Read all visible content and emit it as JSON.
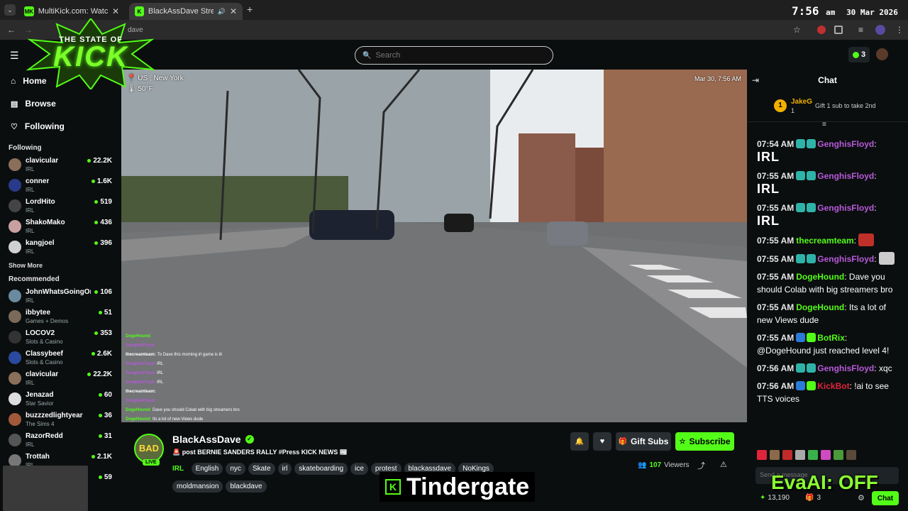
{
  "browser": {
    "tabs": [
      {
        "favicon": "MK",
        "title": "MultiKick.com: Watch Multiple"
      },
      {
        "favicon": "K",
        "title": "BlackAssDave Stream - Wat"
      }
    ],
    "url_fragment": "dave",
    "clock": {
      "time": "7:56",
      "ampm": "am",
      "date": "30 Mar 2026"
    }
  },
  "overlay": {
    "logo_line1": "THE STATE OF",
    "logo_line2": "KICK",
    "caption": "Tindergate",
    "evaai": "EvaAI: OFF"
  },
  "header": {
    "search_placeholder": "Search",
    "notification_count": "3"
  },
  "sidebar": {
    "nav": [
      {
        "label": "Home",
        "icon": "home-icon"
      },
      {
        "label": "Browse",
        "icon": "browse-icon"
      },
      {
        "label": "Following",
        "icon": "heart-icon"
      }
    ],
    "following_title": "Following",
    "following": [
      {
        "name": "clavicular",
        "category": "IRL",
        "viewers": "22.2K",
        "color": "#8a6f5a"
      },
      {
        "name": "conner",
        "category": "IRL",
        "viewers": "1.6K",
        "color": "#2a3a8a"
      },
      {
        "name": "LordHito",
        "category": "IRL",
        "viewers": "519",
        "color": "#444"
      },
      {
        "name": "ShakoMako",
        "category": "IRL",
        "viewers": "436",
        "color": "#c9a0a0"
      },
      {
        "name": "kangjoel",
        "category": "IRL",
        "viewers": "396",
        "color": "#d0d0d0"
      }
    ],
    "show_more": "Show More",
    "recommended_title": "Recommended",
    "recommended": [
      {
        "name": "JohnWhatsGoingOn",
        "category": "IRL",
        "viewers": "106",
        "color": "#6a8aa0"
      },
      {
        "name": "ibbytee",
        "category": "Games + Demos",
        "viewers": "51",
        "color": "#7a6a5a"
      },
      {
        "name": "LOCOV2",
        "category": "Slots & Casino",
        "viewers": "353",
        "color": "#333"
      },
      {
        "name": "Classybeef",
        "category": "Slots & Casino",
        "viewers": "2.6K",
        "color": "#2a4aa0"
      },
      {
        "name": "clavicular",
        "category": "IRL",
        "viewers": "22.2K",
        "color": "#8a6f5a"
      },
      {
        "name": "Jenazad",
        "category": "Star Savior",
        "viewers": "60",
        "color": "#ddd"
      },
      {
        "name": "buzzzedlightyear",
        "category": "The Sims 4",
        "viewers": "36",
        "color": "#a05a3a"
      },
      {
        "name": "RazorRedd",
        "category": "IRL",
        "viewers": "31",
        "color": "#555"
      },
      {
        "name": "Trottah",
        "category": "IRL",
        "viewers": "2.1K",
        "color": "#777"
      },
      {
        "name": "",
        "category": "",
        "viewers": "59",
        "color": "#555"
      }
    ]
  },
  "video": {
    "location": "US , New York",
    "temperature": "50°F",
    "timestamp": "Mar 30, 7:56 AM",
    "overlay_chat": [
      {
        "user": "DogeHound:",
        "text": "",
        "color": "#53fc18"
      },
      {
        "user": "GenghisFloyd:",
        "text": "",
        "color": "#b65ad8"
      },
      {
        "user": "thecreamteam:",
        "text": "To Dave this morning irl game is lit",
        "color": "#fff"
      },
      {
        "user": "GenghisFloyd:",
        "text": "IRL",
        "color": "#b65ad8"
      },
      {
        "user": "GenghisFloyd:",
        "text": "IRL",
        "color": "#b65ad8"
      },
      {
        "user": "GenghisFloyd:",
        "text": "IRL",
        "color": "#b65ad8"
      },
      {
        "user": "thecreamteam:",
        "text": "",
        "color": "#fff"
      },
      {
        "user": "GenghisFloyd:",
        "text": "",
        "color": "#b65ad8"
      },
      {
        "user": "DogeHound:",
        "text": "Dave you should Colab with big streamers bro",
        "color": "#53fc18"
      },
      {
        "user": "DogeHound:",
        "text": "Its a lot of new Views dude",
        "color": "#53fc18"
      }
    ]
  },
  "stream": {
    "channel": "BlackAssDave",
    "live": "LIVE",
    "title": "post BERNIE SANDERS RALLY #Press KICK NEWS",
    "category": "IRL",
    "tags": [
      "English",
      "nyc",
      "Skate",
      "irl",
      "skateboarding",
      "ice",
      "protest",
      "blackassdave",
      "NoKings",
      "moldmansion",
      "blackdave"
    ],
    "viewers": "107",
    "viewers_label": "Viewers",
    "gift_label": "Gift Subs",
    "subscribe_label": "Subscribe"
  },
  "chat": {
    "title": "Chat",
    "pinned_user": "JakeG",
    "pinned_count": "1",
    "pinned_rank": "1",
    "pinned_text": "Gift 1 sub to take 2nd",
    "messages": [
      {
        "time": "07:54 AM",
        "user": "GenghisFloyd",
        "color": "#b65ad8",
        "text": "IRL",
        "big": true,
        "badges": [
          "#2fb3a8",
          "#2fb3a8"
        ]
      },
      {
        "time": "07:55 AM",
        "user": "GenghisFloyd",
        "color": "#b65ad8",
        "text": "IRL",
        "big": true,
        "badges": [
          "#2fb3a8",
          "#2fb3a8"
        ]
      },
      {
        "time": "07:55 AM",
        "user": "GenghisFloyd",
        "color": "#b65ad8",
        "text": "IRL",
        "big": true,
        "badges": [
          "#2fb3a8",
          "#2fb3a8"
        ]
      },
      {
        "time": "07:55 AM",
        "user": "thecreamteam",
        "color": "#53fc18",
        "text": "",
        "big": false,
        "badges": []
      },
      {
        "time": "07:55 AM",
        "user": "GenghisFloyd",
        "color": "#b65ad8",
        "text": "",
        "big": false,
        "badges": [
          "#2fb3a8",
          "#2fb3a8"
        ]
      },
      {
        "time": "07:55 AM",
        "user": "DogeHound",
        "color": "#53fc18",
        "text": "Dave you should Colab with big streamers bro",
        "big": false,
        "badges": []
      },
      {
        "time": "07:55 AM",
        "user": "DogeHound",
        "color": "#53fc18",
        "text": "Its a lot of new Views dude",
        "big": false,
        "badges": []
      },
      {
        "time": "07:55 AM",
        "user": "BotRix",
        "color": "#53fc18",
        "text": "@DogeHound just reached level 4!",
        "big": false,
        "badges": [
          "#2a7ad8",
          "#53fc18"
        ]
      },
      {
        "time": "07:56 AM",
        "user": "GenghisFloyd",
        "color": "#b65ad8",
        "text": "xqc",
        "big": false,
        "badges": [
          "#2fb3a8",
          "#2fb3a8"
        ]
      },
      {
        "time": "07:56 AM",
        "user": "KickBot",
        "color": "#e0243a",
        "text": "!ai to see TTS voices",
        "big": false,
        "badges": [
          "#2a7ad8",
          "#53fc18"
        ]
      }
    ],
    "input_placeholder": "Send a message",
    "points": "13,190",
    "gifts": "3",
    "send_label": "Chat"
  }
}
